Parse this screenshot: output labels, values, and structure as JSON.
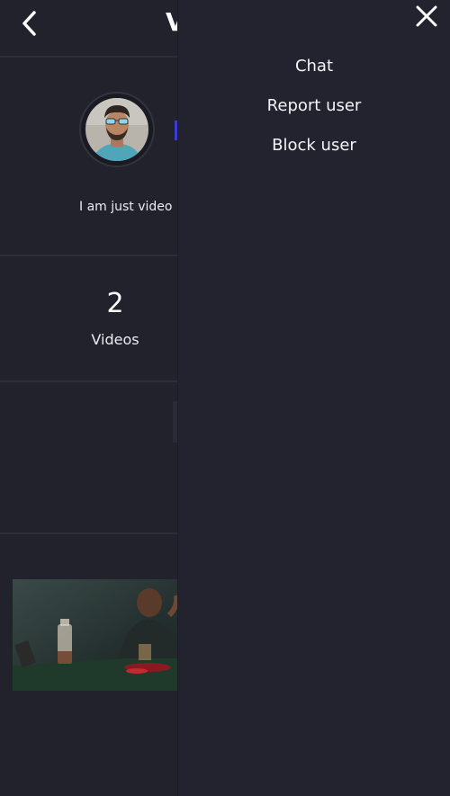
{
  "header": {
    "back_icon": "chevron-left-icon",
    "title_fragment": "V"
  },
  "profile": {
    "avatar_icon": "avatar-photo",
    "bio": "I am just video"
  },
  "stats": {
    "videos_count": "2",
    "videos_label": "Videos"
  },
  "videos": [
    {
      "thumbnail": "video-thumbnail-card-table"
    }
  ],
  "drawer": {
    "close_icon": "close-icon",
    "menu_items": [
      {
        "label": "Chat"
      },
      {
        "label": "Report user"
      },
      {
        "label": "Block user"
      }
    ]
  },
  "colors": {
    "background": "#22222d",
    "drawer_background": "#23232f",
    "divider": "#2d2d3b",
    "accent": "#3b3bd6",
    "text": "#ffffff"
  }
}
